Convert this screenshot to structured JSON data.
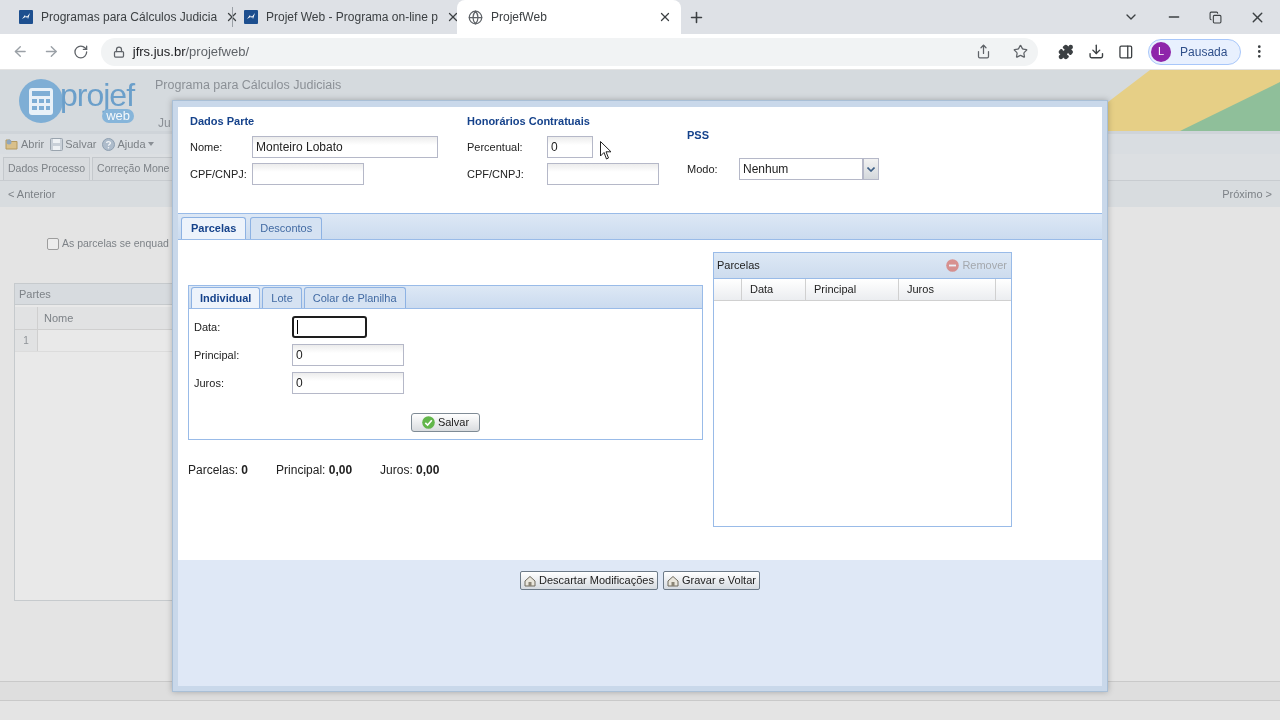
{
  "browser": {
    "tabs": [
      {
        "kind": "site",
        "title": "Programas para Cálculos Judicia",
        "selected": false
      },
      {
        "kind": "site",
        "title": "Projef Web - Programa on-line p",
        "selected": false
      },
      {
        "kind": "globe",
        "title": "ProjefWeb",
        "selected": true
      }
    ],
    "address": {
      "host": "jfrs.jus.br",
      "path": "/projefweb/"
    },
    "profile": {
      "initial": "L",
      "status": "Pausada"
    }
  },
  "app": {
    "logo": {
      "name": "projef",
      "sub": "web"
    },
    "header": {
      "title": "Programa para Cálculos Judiciais",
      "fragment": "Ju"
    },
    "toolbar": [
      {
        "kind": "open",
        "label": "Abrir",
        "menu": false
      },
      {
        "kind": "save",
        "label": "Salvar",
        "menu": false
      },
      {
        "kind": "help",
        "label": "Ajuda",
        "menu": true
      }
    ],
    "tabs": [
      {
        "label": "Dados Processo",
        "selected": false
      },
      {
        "label": "Correção Mone",
        "selected": false
      }
    ],
    "nav": {
      "previous": "< Anterior",
      "next": "Próximo >"
    },
    "option": {
      "label": "As parcelas se enquad",
      "checked": false
    },
    "partes": {
      "title": "Partes",
      "columns": [
        "Nome"
      ],
      "rows": [
        {
          "number": "1"
        }
      ]
    }
  },
  "dialog": {
    "dados_parte": {
      "title": "Dados Parte",
      "fields": [
        {
          "label": "Nome:",
          "value": "Monteiro Lobato"
        },
        {
          "label": "CPF/CNPJ:"
        }
      ]
    },
    "honorarios": {
      "title": "Honorários Contratuais",
      "fields": [
        {
          "label": "Percentual:",
          "value": "0"
        },
        {
          "label": "CPF/CNPJ:"
        }
      ]
    },
    "pss": {
      "title": "PSS",
      "mode": {
        "label": "Modo:",
        "value": "Nenhum"
      }
    },
    "tabs": [
      {
        "label": "Parcelas",
        "selected": true
      },
      {
        "label": "Descontos",
        "selected": false
      }
    ],
    "entry": {
      "tabs": [
        {
          "label": "Individual",
          "selected": true
        },
        {
          "label": "Lote",
          "selected": false
        },
        {
          "label": "Colar de Planilha",
          "selected": false
        }
      ],
      "fields": [
        {
          "label": "Data:",
          "focused": true
        },
        {
          "label": "Principal:",
          "value": "0",
          "focused": false
        },
        {
          "label": "Juros:",
          "value": "0",
          "focused": false
        }
      ],
      "save_button": "Salvar"
    },
    "totals": [
      "Parcelas: **0**",
      "Principal: **0,00**",
      "Juros: **0,00**"
    ],
    "grid": {
      "title": "Parcelas",
      "remove_button": {
        "label": "Remover",
        "disabled": true
      },
      "columns": [
        "Data",
        "Principal",
        "Juros"
      ]
    },
    "buttons": [
      "Descartar Modificações",
      "Gravar e Voltar"
    ]
  }
}
